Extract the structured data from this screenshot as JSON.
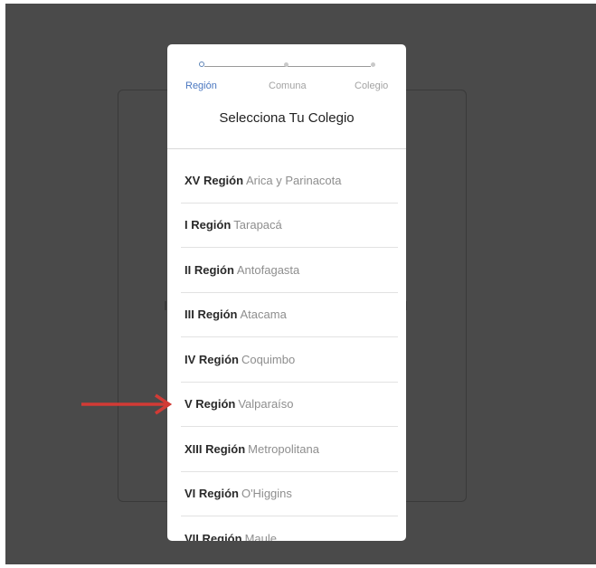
{
  "steps": [
    {
      "label": "Región",
      "active": true
    },
    {
      "label": "Comuna",
      "active": false
    },
    {
      "label": "Colegio",
      "active": false
    }
  ],
  "modal_title": "Selecciona Tu Colegio",
  "regions": [
    {
      "code": "XV Región",
      "name": "Arica y Parinacota"
    },
    {
      "code": "I Región",
      "name": "Tarapacá"
    },
    {
      "code": "II Región",
      "name": "Antofagasta"
    },
    {
      "code": "III Región",
      "name": "Atacama"
    },
    {
      "code": "IV Región",
      "name": "Coquimbo"
    },
    {
      "code": "V Región",
      "name": "Valparaíso"
    },
    {
      "code": "XIII Región",
      "name": "Metropolitana"
    },
    {
      "code": "VI Región",
      "name": "O'Higgins"
    },
    {
      "code": "VII Región",
      "name": "Maule"
    }
  ],
  "annotation": {
    "pointing_to": "V Región",
    "color": "#d23b35"
  },
  "colors": {
    "accent": "#4a77c0",
    "overlay": "#4a4a4a"
  }
}
